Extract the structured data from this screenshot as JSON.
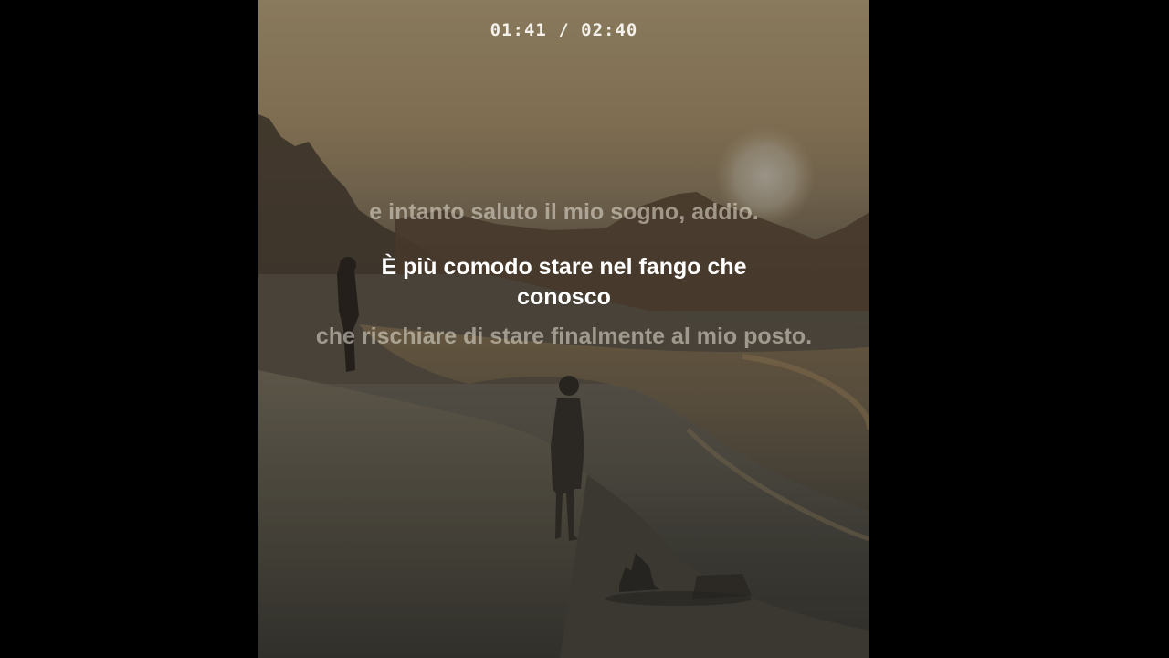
{
  "player": {
    "time_display": "01:41 / 02:40",
    "current_time": "01:41",
    "duration": "02:40"
  },
  "lyrics": {
    "previous_line": "e intanto saluto il mio sogno, addio.",
    "current_line": "È più comodo stare nel fango che conosco",
    "next_line": "che rischiare di stare finalmente al mio posto."
  },
  "colors": {
    "background": "#000000",
    "current_line": "#ffffff",
    "inactive_line": "#bfb7a8"
  }
}
